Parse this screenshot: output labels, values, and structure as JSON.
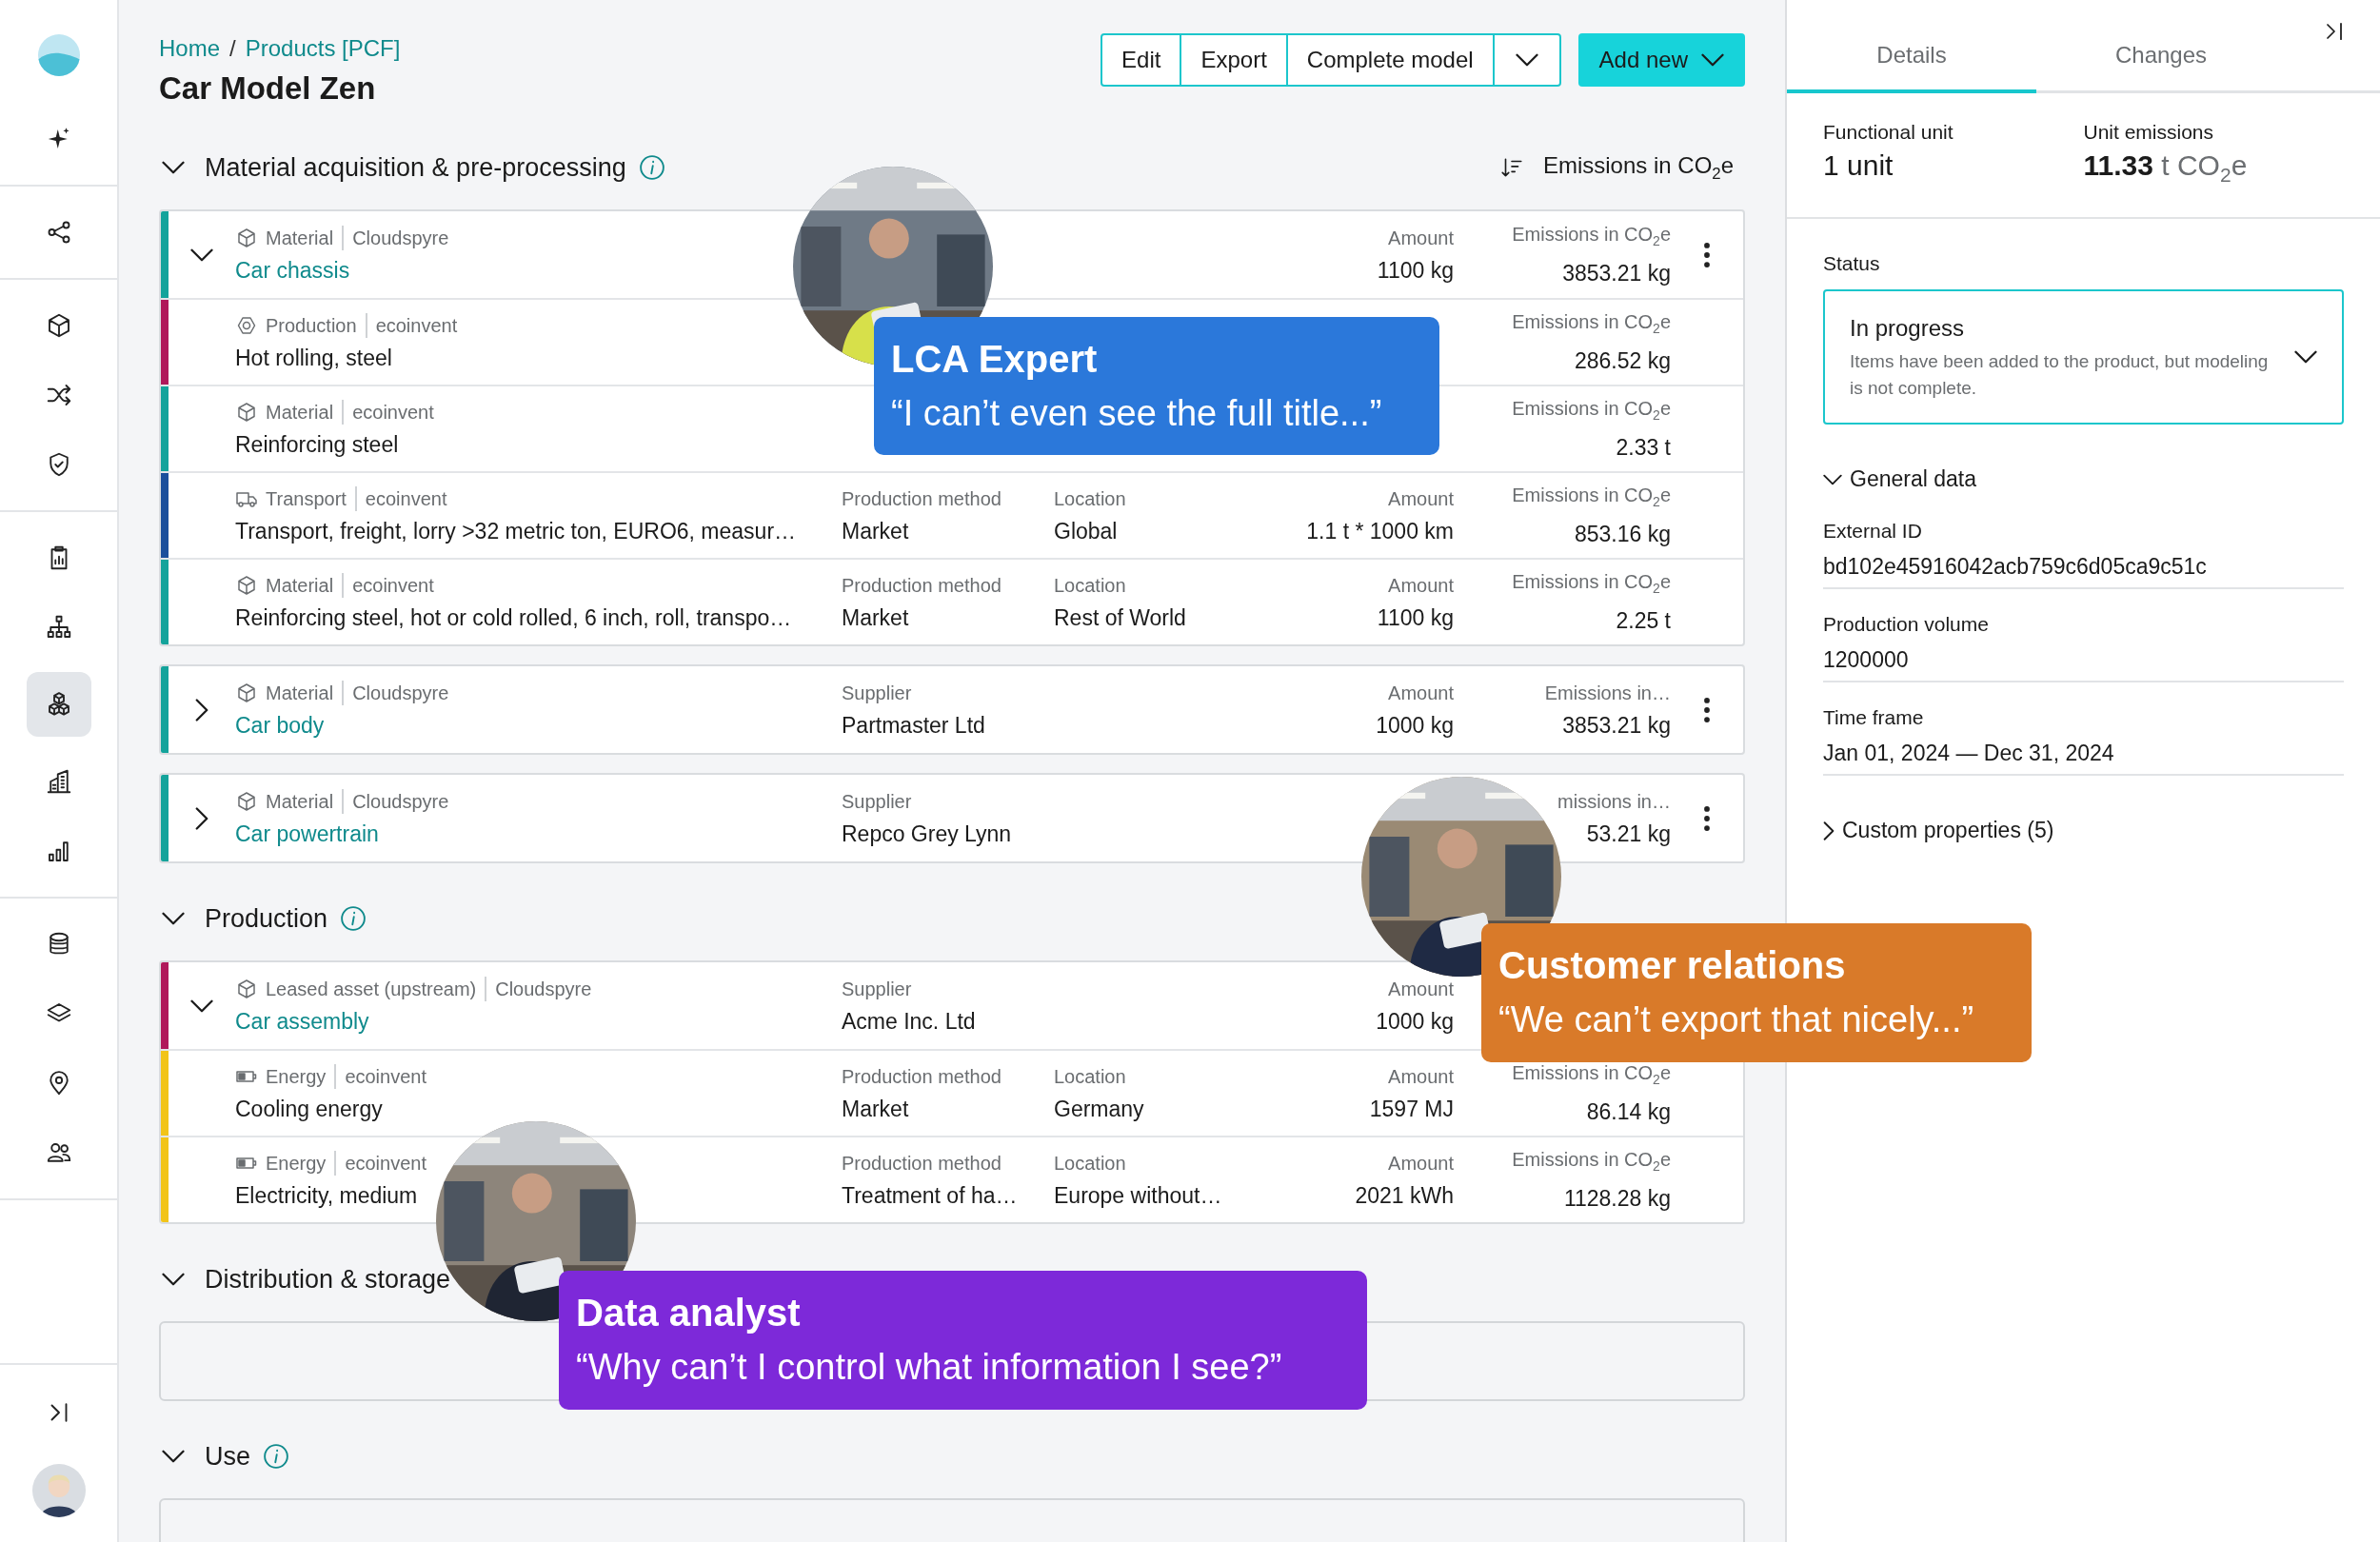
{
  "sidebar": {
    "groups": [
      {
        "items": [
          {
            "kind": "sparkle",
            "selected": false
          }
        ]
      },
      {
        "items": [
          {
            "kind": "share",
            "selected": false
          }
        ]
      },
      {
        "items": [
          {
            "kind": "cube",
            "selected": false
          },
          {
            "kind": "shuffle",
            "selected": false
          },
          {
            "kind": "shield",
            "selected": false
          }
        ]
      },
      {
        "items": [
          {
            "kind": "report",
            "selected": false
          },
          {
            "kind": "hierarchy",
            "selected": false
          },
          {
            "kind": "cubes",
            "selected": true
          },
          {
            "kind": "building",
            "selected": false
          },
          {
            "kind": "chart",
            "selected": false
          }
        ]
      },
      {
        "items": [
          {
            "kind": "database",
            "selected": false
          },
          {
            "kind": "layers",
            "selected": false
          },
          {
            "kind": "pin",
            "selected": false
          },
          {
            "kind": "users",
            "selected": false
          }
        ]
      }
    ]
  },
  "breadcrumb": {
    "items": [
      "Home",
      "Products [PCF]"
    ],
    "separator": "/"
  },
  "title": "Car Model Zen",
  "toolbar": {
    "buttons": [
      {
        "label": "Edit"
      },
      {
        "label": "Export"
      },
      {
        "label": "Complete model"
      }
    ],
    "add_button": {
      "label": "Add new"
    }
  },
  "sections": [
    {
      "title": "Material acquisition & pre-processing",
      "info": true,
      "expanded": true,
      "sort_label": "Emissions in CO$_{2}$e",
      "groups": [
        {
          "expanded": true,
          "item": {
            "kind": "material",
            "color": "#14a39b",
            "type": "Material",
            "source": "Cloudspyre",
            "name": "Car chassis",
            "menu": true,
            "amount": {
              "label": "Amount",
              "value": "1100 kg"
            },
            "emissions": {
              "label": "Emissions in CO$_{2}$e",
              "value": "3853.21 kg"
            }
          },
          "children": [
            {
              "kind": "production",
              "color": "#b0185a",
              "type": "Production",
              "source": "ecoinvent",
              "name": "Hot rolling, steel",
              "emissions": {
                "label": "Emissions in CO$_{2}$e",
                "value": "286.52 kg"
              }
            },
            {
              "kind": "material",
              "color": "#14a39b",
              "type": "Material",
              "source": "ecoinvent",
              "name": "Reinforcing steel",
              "emissions": {
                "label": "Emissions in CO$_{2}$e",
                "value": "2.33 t"
              }
            },
            {
              "kind": "transport",
              "color": "#1b4f9c",
              "type": "Transport",
              "source": "ecoinvent",
              "name": "Transport, freight, lorry >32 metric ton, EURO6, measur…",
              "method": {
                "label": "Production method",
                "value": "Market"
              },
              "location": {
                "label": "Location",
                "value": "Global"
              },
              "amount": {
                "label": "Amount",
                "value": "1.1 t * 1000 km"
              },
              "emissions": {
                "label": "Emissions in CO$_{2}$e",
                "value": "853.16 kg"
              }
            },
            {
              "kind": "material",
              "color": "#14a39b",
              "type": "Material",
              "source": "ecoinvent",
              "name": "Reinforcing steel, hot or cold rolled, 6 inch, roll, transpo…",
              "method": {
                "label": "Production method",
                "value": "Market"
              },
              "location": {
                "label": "Location",
                "value": "Rest of World"
              },
              "amount": {
                "label": "Amount",
                "value": "1100 kg"
              },
              "emissions": {
                "label": "Emissions in CO$_{2}$e",
                "value": "2.25 t"
              }
            }
          ]
        },
        {
          "expanded": false,
          "item": {
            "kind": "material",
            "color": "#14a39b",
            "type": "Material",
            "source": "Cloudspyre",
            "name": "Car body",
            "menu": true,
            "method": {
              "label": "Supplier",
              "value": "Partmaster Ltd"
            },
            "amount": {
              "label": "Amount",
              "value": "1000 kg"
            },
            "emissions": {
              "label": "Emissions in…",
              "value": "3853.21 kg"
            }
          }
        },
        {
          "expanded": false,
          "item": {
            "kind": "material",
            "color": "#14a39b",
            "type": "Material",
            "source": "Cloudspyre",
            "name": "Car powertrain",
            "menu": true,
            "method": {
              "label": "Supplier",
              "value": "Repco Grey Lynn"
            },
            "emissions": {
              "label": "missions in…",
              "value": "53.21 kg"
            }
          }
        }
      ]
    },
    {
      "title": "Production",
      "info": true,
      "expanded": true,
      "groups": [
        {
          "expanded": true,
          "item": {
            "kind": "material",
            "color": "#b0185a",
            "type": "Leased asset (upstream)",
            "source": "Cloudspyre",
            "name": "Car assembly",
            "method": {
              "label": "Supplier",
              "value": "Acme Inc. Ltd"
            },
            "amount": {
              "label": "Amount",
              "value": "1000 kg"
            }
          },
          "children": [
            {
              "kind": "energy",
              "color": "#f2c419",
              "type": "Energy",
              "source": "ecoinvent",
              "name": "Cooling energy",
              "method": {
                "label": "Production method",
                "value": "Market"
              },
              "location": {
                "label": "Location",
                "value": "Germany"
              },
              "amount": {
                "label": "Amount",
                "value": "1597 MJ"
              },
              "emissions": {
                "label": "Emissions in CO$_{2}$e",
                "value": "86.14 kg"
              }
            },
            {
              "kind": "energy",
              "color": "#f2c419",
              "type": "Energy",
              "source": "ecoinvent",
              "name": "Electricity, medium",
              "method": {
                "label": "Production method",
                "value": "Treatment of ha…"
              },
              "location": {
                "label": "Location",
                "value": "Europe without…"
              },
              "amount": {
                "label": "Amount",
                "value": "2021 kWh"
              },
              "emissions": {
                "label": "Emissions in CO$_{2}$e",
                "value": "1128.28 kg"
              }
            }
          ]
        }
      ]
    },
    {
      "title": "Distribution & storage",
      "info": false,
      "expanded": true
    },
    {
      "title": "Use",
      "info": true,
      "expanded": true
    }
  ],
  "details": {
    "tabs": [
      {
        "label": "Details",
        "selected": true
      },
      {
        "label": "Changes",
        "selected": false
      }
    ],
    "functional_unit": {
      "label": "Functional unit",
      "value": "1 unit"
    },
    "unit_emissions": {
      "label": "Unit emissions",
      "value": "11.33",
      "unit": "t CO$_{2}$e"
    },
    "status": {
      "label": "Status",
      "value": "In progress",
      "description": "Items have been added to the product, but modeling is not complete."
    },
    "general": {
      "title": "General data",
      "expanded": true,
      "fields": [
        {
          "label": "External ID",
          "value": "bd102e45916042acb759c6d05ca9c51c"
        },
        {
          "label": "Production volume",
          "value": "1200000"
        },
        {
          "label": "Time frame",
          "value": "Jan 01, 2024 — Dec 31, 2024"
        }
      ]
    },
    "custom": {
      "title": "Custom properties (5)",
      "expanded": false
    }
  },
  "callouts": [
    {
      "title": "LCA Expert",
      "quote": "“I can’t even see the full title...”",
      "color": "#2b78da"
    },
    {
      "title": "Customer relations",
      "quote": "“We can’t export that nicely...”",
      "color": "#d97a29"
    },
    {
      "title": "Data analyst",
      "quote": "“Why can’t I control what information I see?”",
      "color": "#7d29d9"
    }
  ]
}
